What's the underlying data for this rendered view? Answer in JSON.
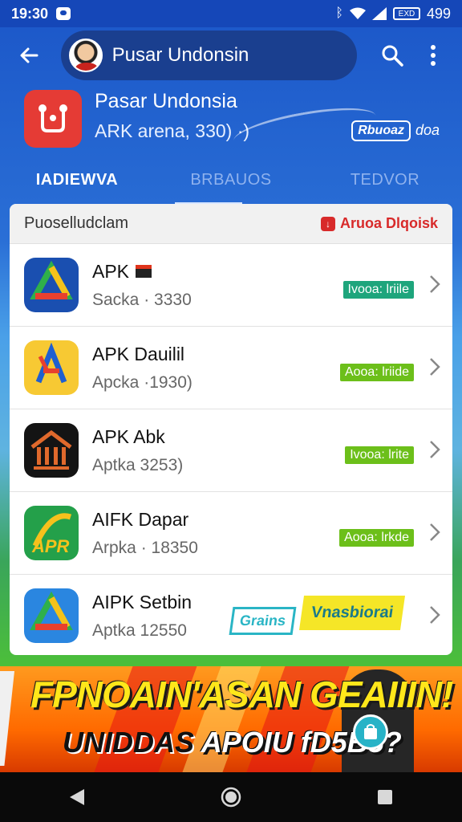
{
  "status_bar": {
    "time": "19:30",
    "battery_label": "EXD",
    "battery_percent": "499"
  },
  "app_bar": {
    "title": "Pusar Undonsin",
    "icons": [
      "back-arrow-icon",
      "search-icon",
      "more-vert-icon"
    ]
  },
  "header": {
    "name": "Pasar Undonsia",
    "subtitle": "ARK arena, 330) ·)",
    "promo_tag": "Rbuoaz",
    "promo_suffix": "doa"
  },
  "tabs": [
    {
      "label": "IADIEWVA",
      "active": true
    },
    {
      "label": "BRBAUOS",
      "active": false
    },
    {
      "label": "TEDVOR",
      "active": false
    }
  ],
  "list": {
    "section_title": "Puoselludclam",
    "action_label": "Aruoa Dlqoisk",
    "items": [
      {
        "title": "APK",
        "subtitle": "Sacka · 3330",
        "badge": "Ivooa: lriile",
        "badge_color": "#1ea57c",
        "icon": "drive-triangle-icon"
      },
      {
        "title": "APK Dauilil",
        "subtitle": "Apcka ·1930)",
        "badge": "Aooa: lriide",
        "badge_color": "#6cbf1a",
        "icon": "letter-a-icon"
      },
      {
        "title": "APK Abk",
        "subtitle": "Aptka 3253)",
        "badge": "Ivooa: lrite",
        "badge_color": "#6cbf1a",
        "icon": "building-icon"
      },
      {
        "title": "AIFK Dapar",
        "subtitle": "Arpka · 18350",
        "badge": "Aooa: lrkde",
        "badge_color": "#6cbf1a",
        "icon": "apr-leaf-icon"
      },
      {
        "title": "AIPK Setbin",
        "subtitle": "Aptka 12550",
        "badge": "",
        "badge_color": "",
        "icon": "drive-triangle-icon"
      }
    ],
    "overlay_badges": {
      "teal": "Grains",
      "yellow": "Vnasbiorai"
    }
  },
  "banner": {
    "line1": "FPNOAIN'ASAN GEAIIIN!",
    "line2_a": "UNIDDAS",
    "line2_b": "APOIU fD5B5?",
    "colors": {
      "yellow": "#ffe71a",
      "orange": "#ff6a00"
    }
  },
  "nav_bar": {
    "icons": [
      "nav-back-icon",
      "nav-home-icon",
      "nav-recents-icon"
    ]
  },
  "colors": {
    "primary": "#1b56c8",
    "accent_red": "#e53b35",
    "badge_teal": "#1ea57c",
    "badge_green": "#6cbf1a"
  }
}
